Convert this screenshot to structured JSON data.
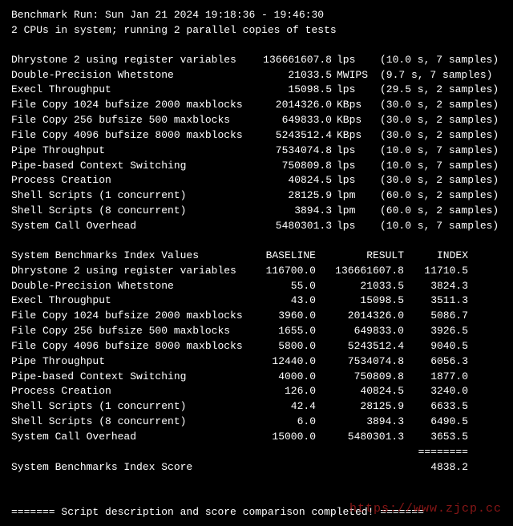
{
  "header": {
    "line1": "Benchmark Run: Sun Jan 21 2024 19:18:36 - 19:46:30",
    "line2": "2 CPUs in system; running 2 parallel copies of tests"
  },
  "results": [
    {
      "name": "Dhrystone 2 using register variables",
      "value": "136661607.8",
      "unit": "lps",
      "timing": "(10.0 s, 7 samples)"
    },
    {
      "name": "Double-Precision Whetstone",
      "value": "21033.5",
      "unit": "MWIPS",
      "timing": "(9.7 s, 7 samples)"
    },
    {
      "name": "Execl Throughput",
      "value": "15098.5",
      "unit": "lps",
      "timing": "(29.5 s, 2 samples)"
    },
    {
      "name": "File Copy 1024 bufsize 2000 maxblocks",
      "value": "2014326.0",
      "unit": "KBps",
      "timing": "(30.0 s, 2 samples)"
    },
    {
      "name": "File Copy 256 bufsize 500 maxblocks",
      "value": "649833.0",
      "unit": "KBps",
      "timing": "(30.0 s, 2 samples)"
    },
    {
      "name": "File Copy 4096 bufsize 8000 maxblocks",
      "value": "5243512.4",
      "unit": "KBps",
      "timing": "(30.0 s, 2 samples)"
    },
    {
      "name": "Pipe Throughput",
      "value": "7534074.8",
      "unit": "lps",
      "timing": "(10.0 s, 7 samples)"
    },
    {
      "name": "Pipe-based Context Switching",
      "value": "750809.8",
      "unit": "lps",
      "timing": "(10.0 s, 7 samples)"
    },
    {
      "name": "Process Creation",
      "value": "40824.5",
      "unit": "lps",
      "timing": "(30.0 s, 2 samples)"
    },
    {
      "name": "Shell Scripts (1 concurrent)",
      "value": "28125.9",
      "unit": "lpm",
      "timing": "(60.0 s, 2 samples)"
    },
    {
      "name": "Shell Scripts (8 concurrent)",
      "value": "3894.3",
      "unit": "lpm",
      "timing": "(60.0 s, 2 samples)"
    },
    {
      "name": "System Call Overhead",
      "value": "5480301.3",
      "unit": "lps",
      "timing": "(10.0 s, 7 samples)"
    }
  ],
  "index_header": {
    "title": "System Benchmarks Index Values",
    "baseline": "BASELINE",
    "result": "RESULT",
    "index": "INDEX"
  },
  "index": [
    {
      "name": "Dhrystone 2 using register variables",
      "baseline": "116700.0",
      "result": "136661607.8",
      "index": "11710.5"
    },
    {
      "name": "Double-Precision Whetstone",
      "baseline": "55.0",
      "result": "21033.5",
      "index": "3824.3"
    },
    {
      "name": "Execl Throughput",
      "baseline": "43.0",
      "result": "15098.5",
      "index": "3511.3"
    },
    {
      "name": "File Copy 1024 bufsize 2000 maxblocks",
      "baseline": "3960.0",
      "result": "2014326.0",
      "index": "5086.7"
    },
    {
      "name": "File Copy 256 bufsize 500 maxblocks",
      "baseline": "1655.0",
      "result": "649833.0",
      "index": "3926.5"
    },
    {
      "name": "File Copy 4096 bufsize 8000 maxblocks",
      "baseline": "5800.0",
      "result": "5243512.4",
      "index": "9040.5"
    },
    {
      "name": "Pipe Throughput",
      "baseline": "12440.0",
      "result": "7534074.8",
      "index": "6056.3"
    },
    {
      "name": "Pipe-based Context Switching",
      "baseline": "4000.0",
      "result": "750809.8",
      "index": "1877.0"
    },
    {
      "name": "Process Creation",
      "baseline": "126.0",
      "result": "40824.5",
      "index": "3240.0"
    },
    {
      "name": "Shell Scripts (1 concurrent)",
      "baseline": "42.4",
      "result": "28125.9",
      "index": "6633.5"
    },
    {
      "name": "Shell Scripts (8 concurrent)",
      "baseline": "6.0",
      "result": "3894.3",
      "index": "6490.5"
    },
    {
      "name": "System Call Overhead",
      "baseline": "15000.0",
      "result": "5480301.3",
      "index": "3653.5"
    }
  ],
  "rule": "========",
  "score": {
    "label": "System Benchmarks Index Score",
    "value": "4838.2"
  },
  "footer": "======= Script description and score comparison completed! =======",
  "watermark": "https://www.zjcp.cc"
}
